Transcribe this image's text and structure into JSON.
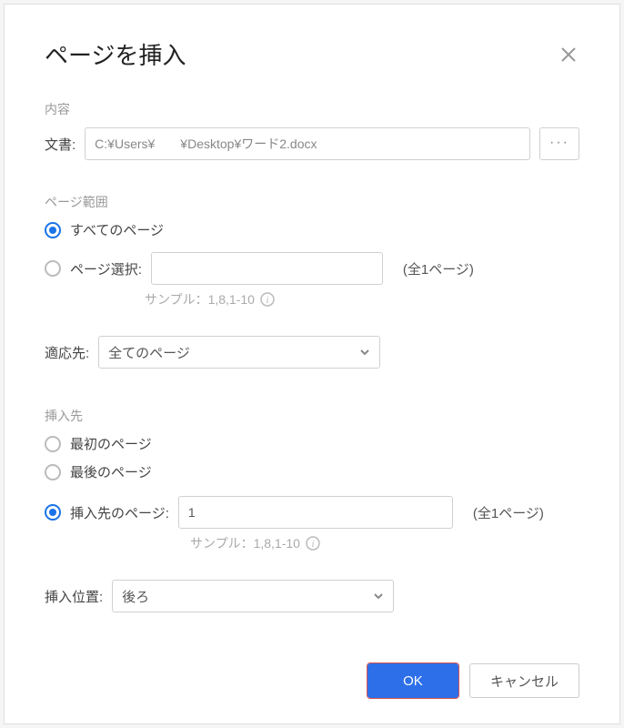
{
  "dialog": {
    "title": "ページを挿入"
  },
  "content": {
    "section_label": "内容",
    "file_label": "文書:",
    "file_value": "C:¥Users¥　　¥Desktop¥ワード2.docx",
    "browse_label": "···"
  },
  "range": {
    "section_label": "ページ範囲",
    "all_pages_label": "すべてのページ",
    "select_pages_label": "ページ選択:",
    "select_pages_value": "",
    "total_label": "(全1ページ)",
    "sample_hint": "サンプル：1,8,1-10",
    "apply_label": "適応先:",
    "apply_selected": "全てのページ"
  },
  "destination": {
    "section_label": "挿入先",
    "first_label": "最初のページ",
    "last_label": "最後のページ",
    "page_label": "挿入先のページ:",
    "page_value": "1",
    "total_label": "(全1ページ)",
    "sample_hint": "サンプル：1,8,1-10",
    "position_label": "挿入位置:",
    "position_selected": "後ろ"
  },
  "footer": {
    "ok_label": "OK",
    "cancel_label": "キャンセル"
  }
}
